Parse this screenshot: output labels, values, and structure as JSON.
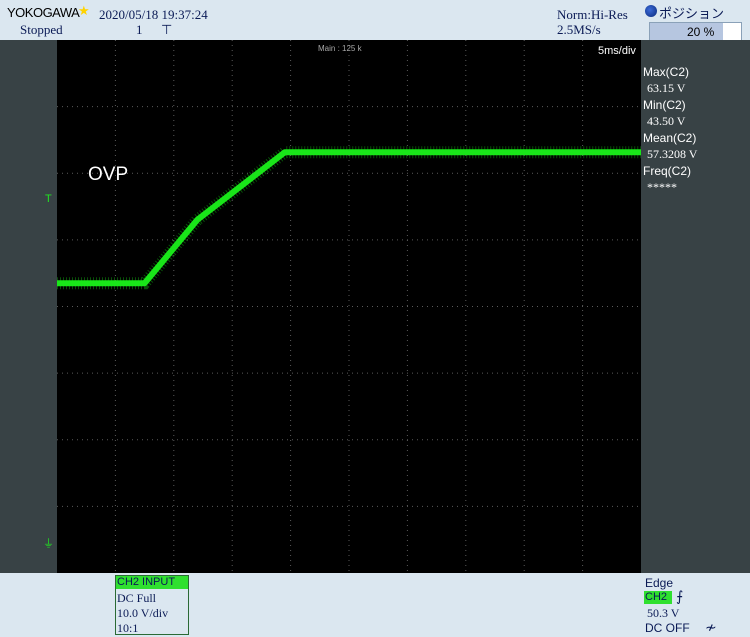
{
  "header": {
    "brand": "YOKOGAWA",
    "brand_star": "★",
    "datetime": "2020/05/18 19:37:24",
    "status": "Stopped",
    "acq_count": "1",
    "trigger_mode_symbol": "⊤",
    "acq_mode": "Norm:Hi-Res",
    "sample_rate": "2.5MS/s"
  },
  "position_control": {
    "label": "ポジション",
    "value": "20 %",
    "fraction": 0.2
  },
  "screen": {
    "main_record": "Main : 125 k",
    "timebase": "5ms/div",
    "annotation": "OVP",
    "trigger_marker": "T",
    "ground_marker": "⏚",
    "trace_color": "#19e619"
  },
  "chart_data": {
    "type": "line",
    "title": "",
    "xlabel": "",
    "ylabel": "",
    "x_unit": "ms",
    "y_unit": "V",
    "xlim": [
      0,
      50
    ],
    "ylim": [
      0,
      80
    ],
    "grid": "10x8 dotted",
    "series": [
      {
        "values": [
          {
            "x": 0,
            "y": 43.5
          },
          {
            "x": 7.5,
            "y": 43.5
          },
          {
            "x": 12,
            "y": 53
          },
          {
            "x": 19.5,
            "y": 63.15
          },
          {
            "x": 50,
            "y": 63.15
          }
        ]
      }
    ]
  },
  "measurements": [
    {
      "label": "Max(C2)",
      "value": "63.15 V"
    },
    {
      "label": "Min(C2)",
      "value": "43.50 V"
    },
    {
      "label": "Mean(C2)",
      "value": "57.3208 V"
    },
    {
      "label": "Freq(C2)",
      "value": "*****"
    }
  ],
  "channel": {
    "title": "CH2 INPUT",
    "coupling": "DC Full",
    "scale": "10.0 V/div",
    "probe": "10:1"
  },
  "trigger": {
    "type": "Edge",
    "source": "CH2",
    "slope_symbol": "⨍",
    "level": "50.3 V",
    "coupling": "DC OFF",
    "hf_symbol": "≁"
  }
}
